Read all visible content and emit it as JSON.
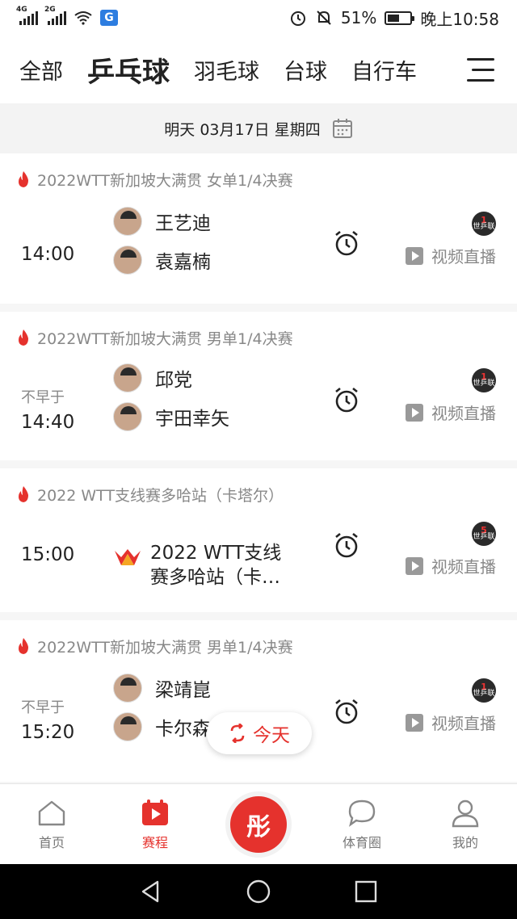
{
  "status_bar": {
    "sim1_label": "4G",
    "sim2_label": "2G",
    "app_badge": "G",
    "battery": "51%",
    "battery_level": 0.51,
    "time": "晚上10:58"
  },
  "tabs": [
    {
      "label": "全部",
      "active": false
    },
    {
      "label": "乒乓球",
      "active": true
    },
    {
      "label": "羽毛球",
      "active": false
    },
    {
      "label": "台球",
      "active": false
    },
    {
      "label": "自行车",
      "active": false
    }
  ],
  "date_bar": {
    "text": "明天 03月17日 星期四"
  },
  "matches": [
    {
      "title": "2022WTT新加坡大满贯 女单1/4决赛",
      "time": "14:00",
      "players": [
        "王艺迪",
        "袁嘉楠"
      ],
      "badge_num": "1",
      "badge_text": "世乒联",
      "live_label": "视频直播"
    },
    {
      "title": "2022WTT新加坡大满贯 男单1/4决赛",
      "pre": "不早于",
      "time": "14:40",
      "players": [
        "邱党",
        "宇田幸矢"
      ],
      "badge_num": "1",
      "badge_text": "世乒联",
      "live_label": "视频直播"
    },
    {
      "title": "2022 WTT支线赛多哈站（卡塔尔）",
      "time": "15:00",
      "event_line1": "2022 WTT支线",
      "event_line2": "赛多哈站（卡…",
      "badge_num": "5",
      "badge_text": "世乒联",
      "live_label": "视频直播"
    },
    {
      "title": "2022WTT新加坡大满贯 男单1/4决赛",
      "pre": "不早于",
      "time": "15:20",
      "players": [
        "梁靖崑",
        "卡尔森"
      ],
      "badge_num": "1",
      "badge_text": "世乒联",
      "live_label": "视频直播"
    }
  ],
  "today_button": "今天",
  "bottom_nav": [
    {
      "label": "首页",
      "icon": "home-icon"
    },
    {
      "label": "赛程",
      "icon": "schedule-icon",
      "active": true
    },
    {
      "label": "",
      "icon": "center-logo"
    },
    {
      "label": "体育圈",
      "icon": "chat-icon"
    },
    {
      "label": "我的",
      "icon": "user-icon"
    }
  ],
  "center_logo_text": "彤",
  "colors": {
    "accent": "#e5322d",
    "muted": "#888888"
  }
}
